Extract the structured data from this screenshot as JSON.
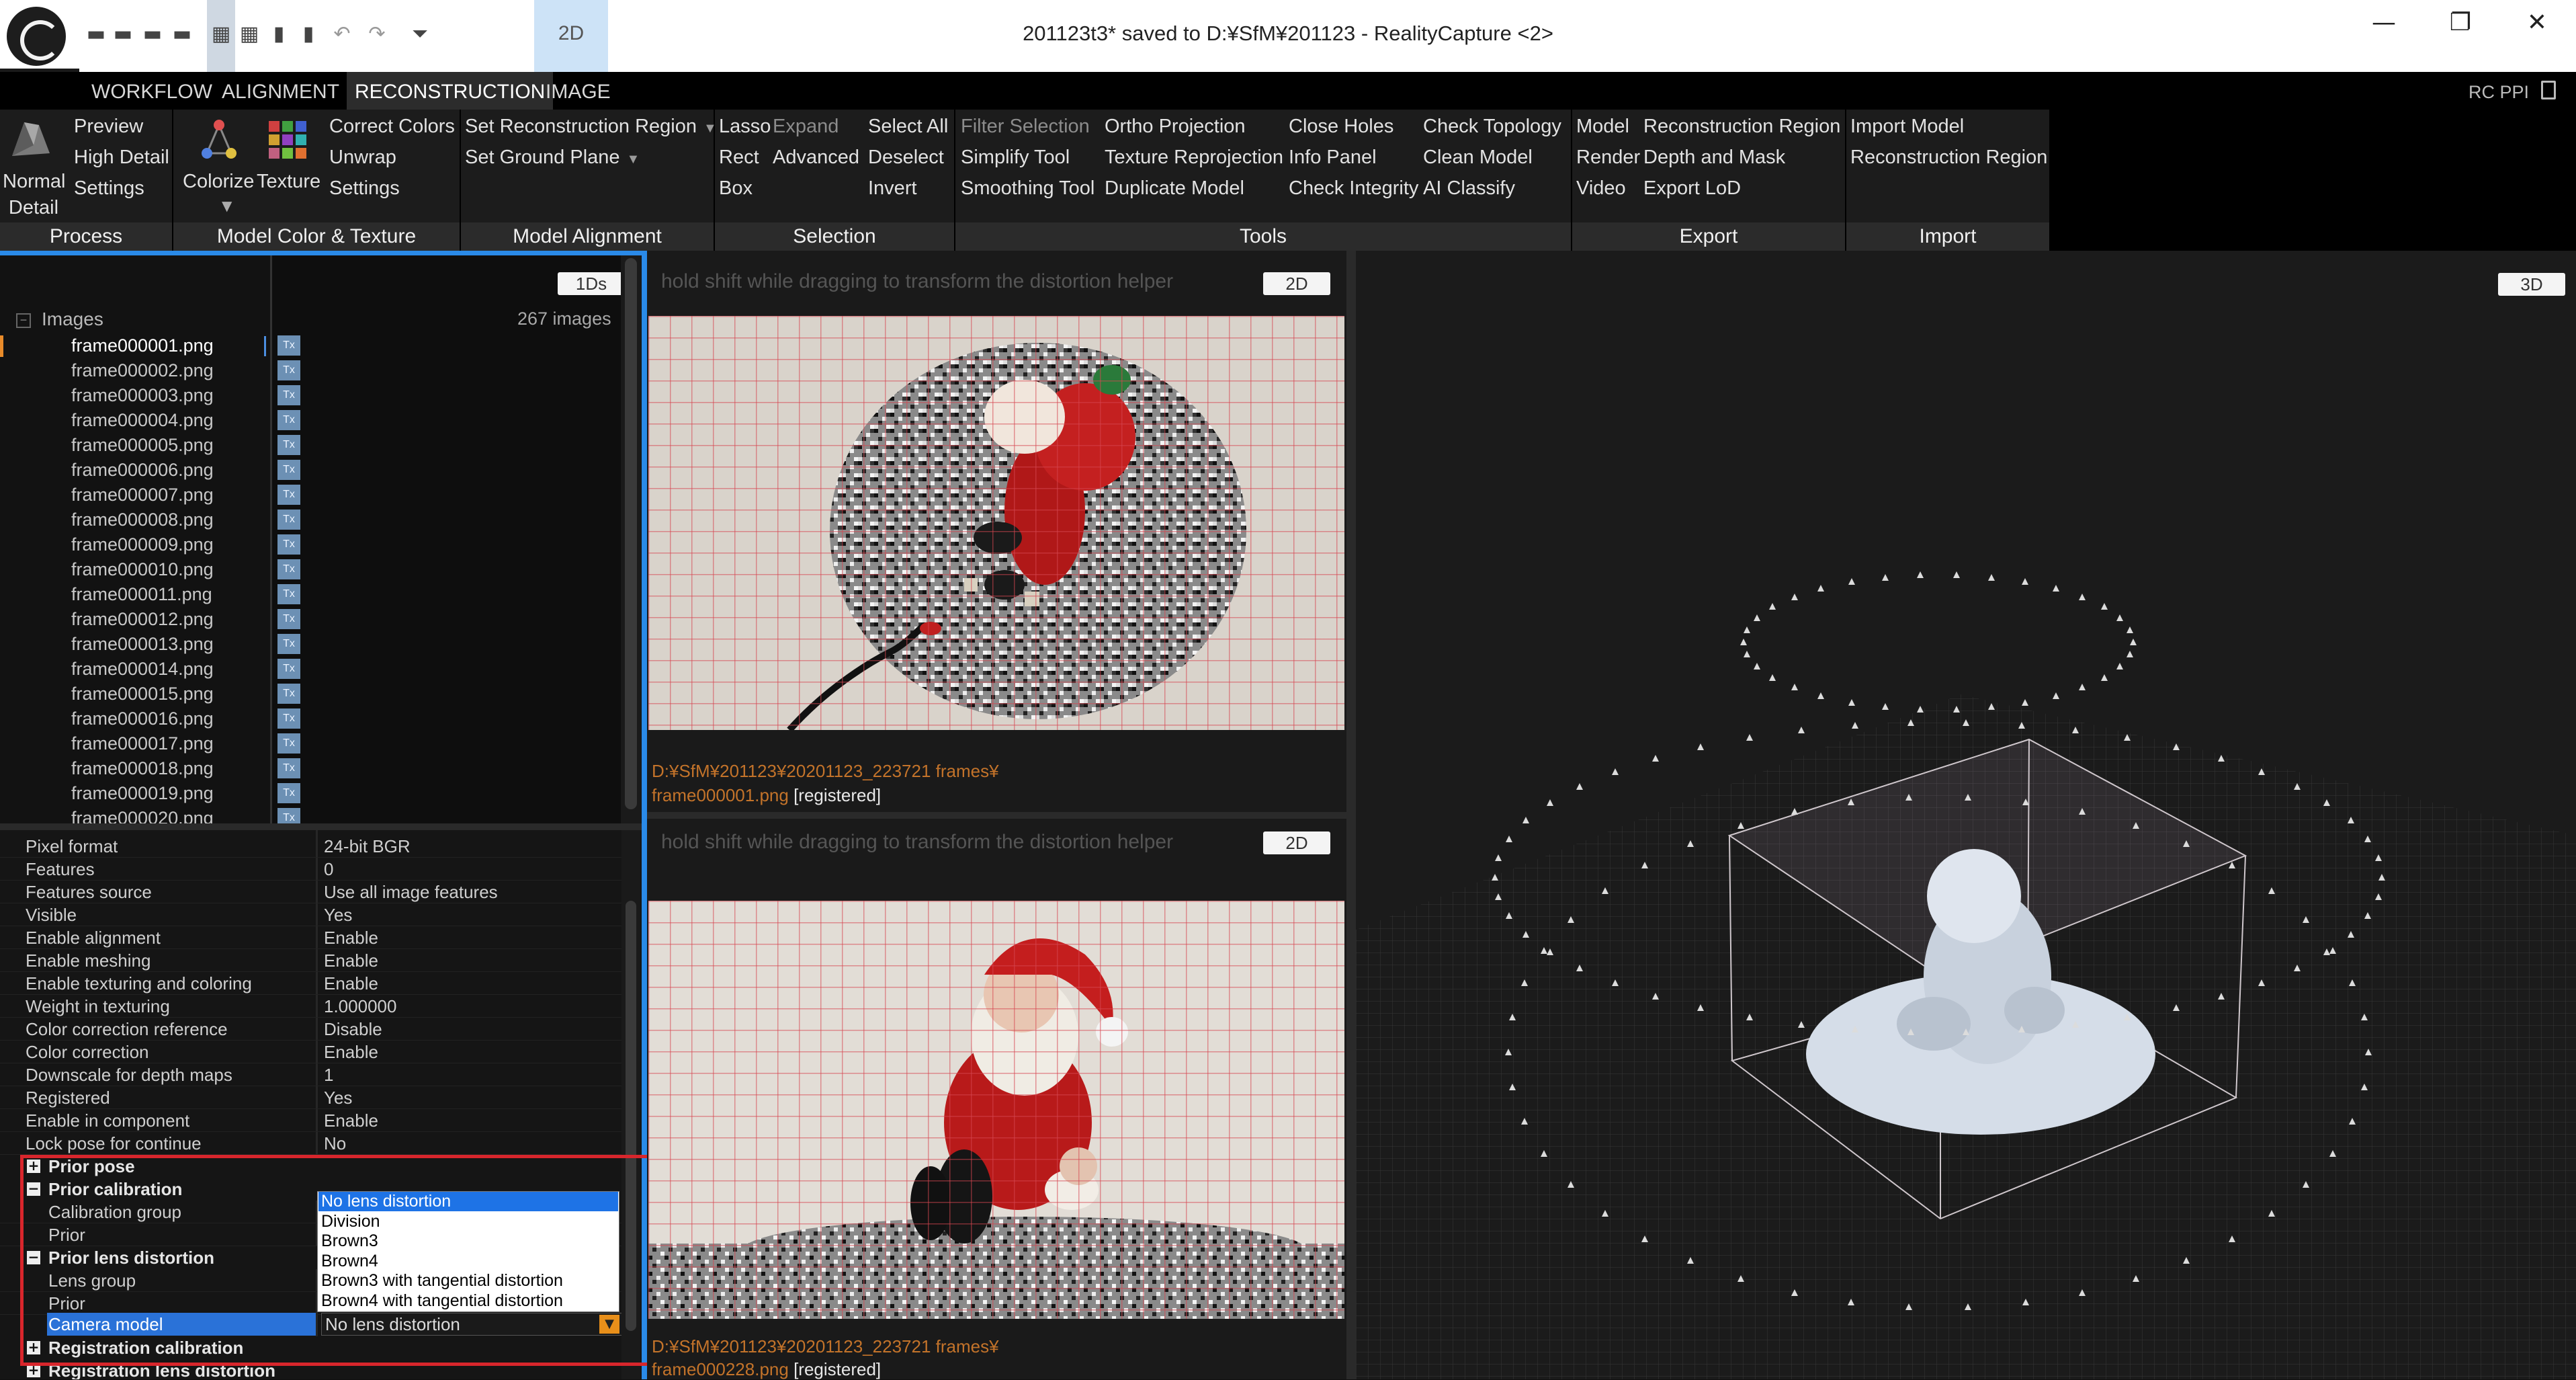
{
  "titlebar": {
    "title": "201123t3* saved to D:¥SfM¥201123 - RealityCapture <2>",
    "mode_label": "2D",
    "quick_access_icons": [
      "layout-1-icon",
      "layout-2-icon",
      "layout-3-icon",
      "layout-4-icon",
      "layout-5-icon",
      "layout-6-icon",
      "layout-7-icon",
      "layout-8-icon",
      "undo-icon",
      "redo-icon",
      "customize-icon"
    ],
    "window_buttons": {
      "minimize": "—",
      "restore": "❐",
      "close": "✕"
    }
  },
  "menubar": {
    "items": [
      "WORKFLOW",
      "ALIGNMENT",
      "RECONSTRUCTION",
      "IMAGE"
    ],
    "active": "RECONSTRUCTION",
    "right_label": "RC PPI"
  },
  "ribbon": {
    "process": {
      "label": "Process",
      "big_button": [
        "Normal",
        "Detail"
      ],
      "items": [
        "Preview",
        "High Detail",
        "Settings"
      ]
    },
    "model_color_texture": {
      "label": "Model Color & Texture",
      "colorize": "Colorize",
      "texture": "Texture",
      "items": [
        "Correct Colors",
        "Unwrap",
        "Settings"
      ]
    },
    "model_alignment": {
      "label": "Model Alignment",
      "items": [
        "Set Reconstruction Region",
        "Set Ground Plane"
      ]
    },
    "selection": {
      "label": "Selection",
      "col1": [
        "Lasso",
        "Rect",
        "Box"
      ],
      "col2": [
        "Expand",
        "Advanced"
      ],
      "col3": [
        "Select All",
        "Deselect",
        "Invert"
      ]
    },
    "tools": {
      "label": "Tools",
      "col1": [
        "Filter Selection",
        "Simplify Tool",
        "Smoothing Tool"
      ],
      "col2": [
        "Ortho Projection",
        "Texture Reprojection",
        "Duplicate Model"
      ],
      "col3": [
        "Close Holes",
        "Info Panel",
        "Check Integrity"
      ],
      "col4": [
        "Check Topology",
        "Clean Model",
        "AI Classify"
      ]
    },
    "export": {
      "label": "Export",
      "col1": [
        "Model",
        "Render",
        "Video"
      ],
      "col2": [
        "Reconstruction Region",
        "Depth and Mask",
        "Export LoD"
      ]
    },
    "import": {
      "label": "Import",
      "items": [
        "Import Model",
        "Reconstruction Region"
      ]
    }
  },
  "left_panel": {
    "view_button": "1Ds",
    "tree_root": "Images",
    "image_count": "267 images",
    "images": [
      "frame000001.png",
      "frame000002.png",
      "frame000003.png",
      "frame000004.png",
      "frame000005.png",
      "frame000006.png",
      "frame000007.png",
      "frame000008.png",
      "frame000009.png",
      "frame000010.png",
      "frame000011.png",
      "frame000012.png",
      "frame000013.png",
      "frame000014.png",
      "frame000015.png",
      "frame000016.png",
      "frame000017.png",
      "frame000018.png",
      "frame000019.png",
      "frame000020.png"
    ],
    "selected_image": "frame000001.png",
    "tex_badge": "Tx",
    "properties": [
      {
        "k": "Pixel format",
        "v": "24-bit BGR"
      },
      {
        "k": "Features",
        "v": "0"
      },
      {
        "k": "Features source",
        "v": "Use all image features"
      },
      {
        "k": "Visible",
        "v": "Yes"
      },
      {
        "k": "Enable alignment",
        "v": "Enable"
      },
      {
        "k": "Enable meshing",
        "v": "Enable"
      },
      {
        "k": "Enable texturing and coloring",
        "v": "Enable"
      },
      {
        "k": "Weight in texturing",
        "v": "1.000000"
      },
      {
        "k": "Color correction reference",
        "v": "Disable"
      },
      {
        "k": "Color correction",
        "v": "Enable"
      },
      {
        "k": "Downscale for depth maps",
        "v": "1"
      },
      {
        "k": "Registered",
        "v": "Yes"
      },
      {
        "k": "Enable in component",
        "v": "Enable"
      },
      {
        "k": "Lock pose for continue",
        "v": "No"
      }
    ],
    "sections": {
      "prior_pose": "Prior pose",
      "prior_calibration": "Prior calibration",
      "calibration_group": "Calibration group",
      "prior_1": "Prior",
      "prior_lens_distortion": "Prior lens distortion",
      "lens_group": "Lens group",
      "prior_2": "Prior",
      "camera_model": "Camera model",
      "registration_calibration": "Registration calibration",
      "registration_lens_distortion": "Registration lens distortion"
    },
    "camera_model_value": "No lens distortion",
    "camera_model_options": [
      "No lens distortion",
      "Division",
      "Brown3",
      "Brown4",
      "Brown3 with tangential distortion",
      "Brown4 with tangential distortion"
    ],
    "expand_symbol": "+",
    "collapse_symbol": "−"
  },
  "view_top": {
    "hint": "hold shift while dragging to transform the distortion helper",
    "button": "2D",
    "path": "D:¥SfM¥201123¥20201123_223721 frames¥",
    "file": "frame000001.png",
    "status": "[registered]"
  },
  "view_bottom": {
    "hint": "hold shift while dragging to transform the distortion helper",
    "button": "2D",
    "path": "D:¥SfM¥201123¥20201123_223721 frames¥",
    "file": "frame000228.png",
    "status": "[registered]"
  },
  "view_3d": {
    "button": "3D"
  },
  "colors": {
    "accent_blue": "#2a8ae8",
    "highlight_red": "#d8262c",
    "path_orange": "#c3732a",
    "selection_blue": "#1e73e6"
  }
}
